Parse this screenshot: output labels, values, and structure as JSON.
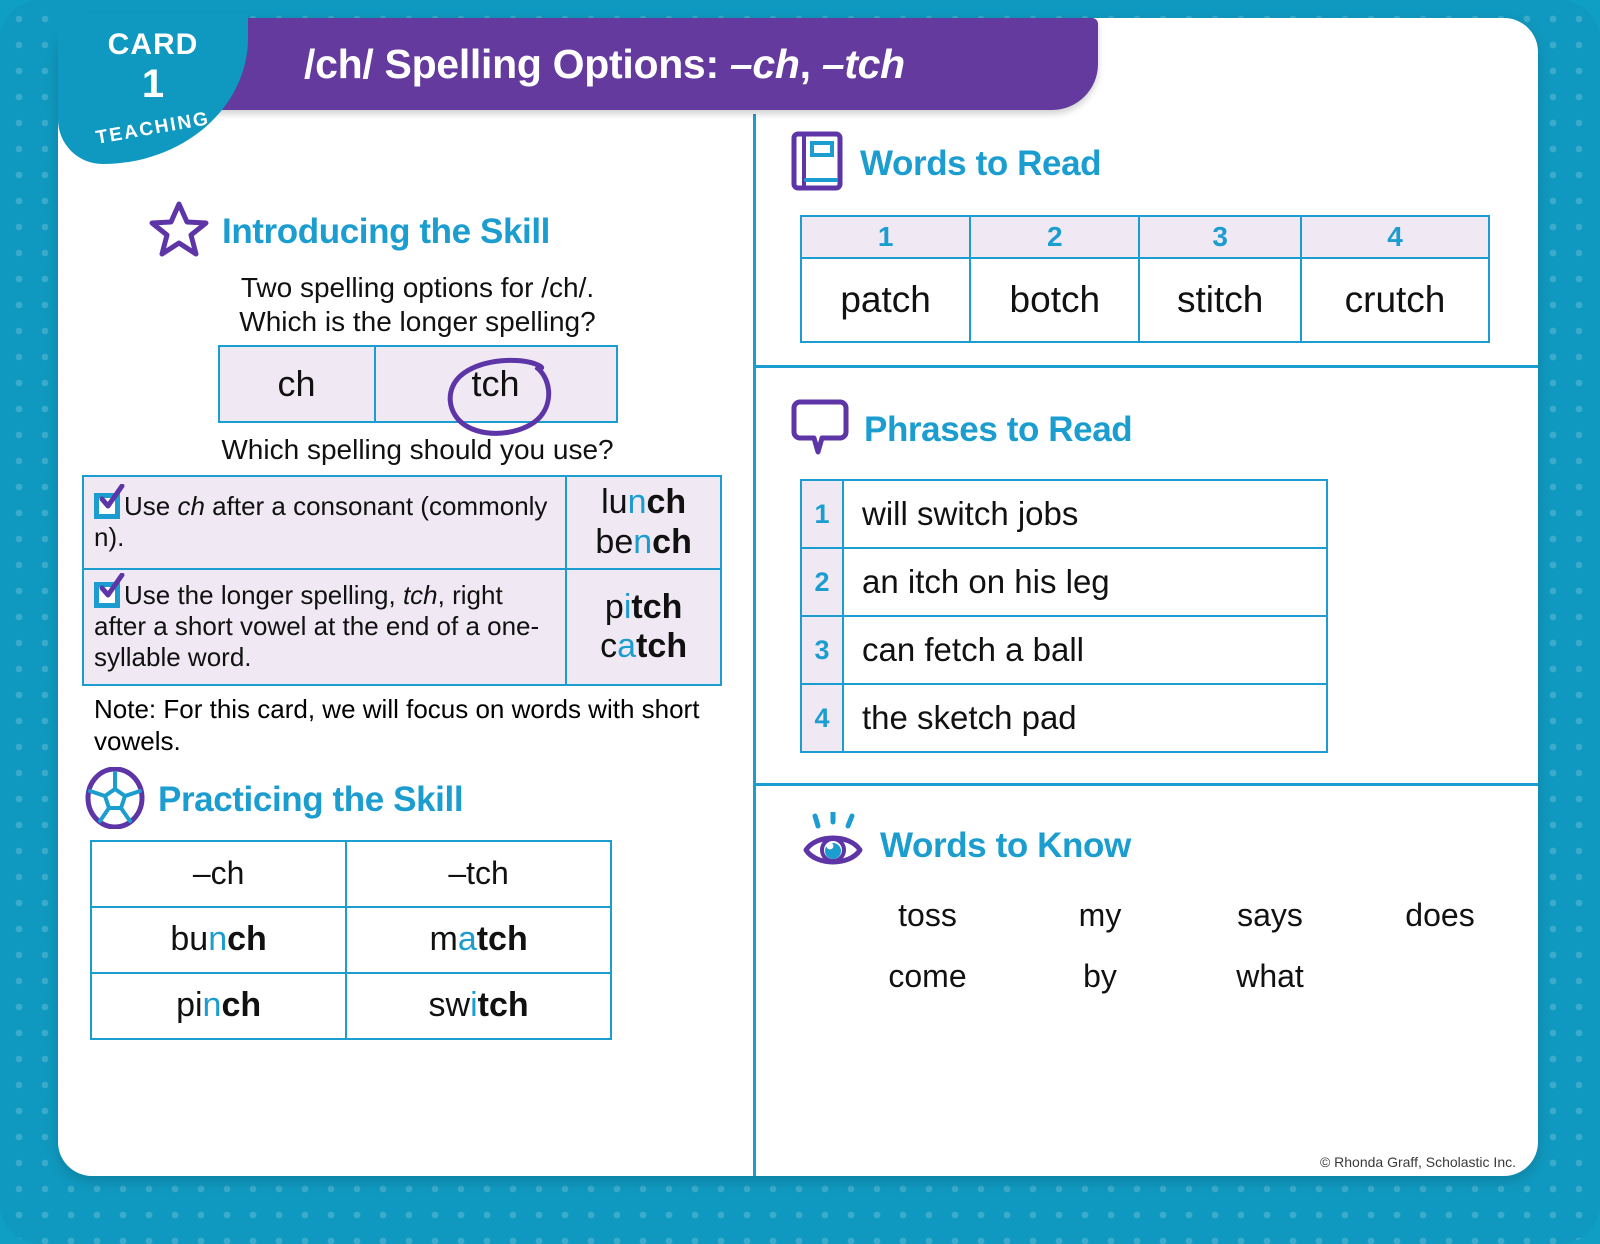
{
  "badge": {
    "card_label": "CARD",
    "number": "1",
    "type_label": "TEACHING"
  },
  "header": {
    "title_main": "/ch/ Spelling Options: ",
    "title_opt1": "–ch",
    "title_sep": ", ",
    "title_opt2": "–tch"
  },
  "left": {
    "intro": {
      "heading": "Introducing the Skill",
      "icon": "star-icon",
      "line1": "Two spelling options for /ch/.",
      "line2": "Which is the longer spelling?",
      "option_a": "ch",
      "option_b": "tch",
      "circled_option": "tch",
      "question2": "Which spelling should you use?"
    },
    "rules": [
      {
        "text_a": "Use ",
        "text_italic": "ch",
        "text_b": " after a consonant (commonly n).",
        "examples": [
          {
            "pre": "lu",
            "mid": "n",
            "post": "ch"
          },
          {
            "pre": "be",
            "mid": "n",
            "post": "ch"
          }
        ]
      },
      {
        "text_a": "Use the longer spelling, ",
        "text_italic": "tch",
        "text_b": ", right after a short vowel at the end of a one-syllable word.",
        "examples": [
          {
            "pre": "p",
            "mid": "i",
            "post": "tch"
          },
          {
            "pre": "c",
            "mid": "a",
            "post": "tch"
          }
        ]
      }
    ],
    "note": "Note: For this card, we will focus on words with short vowels.",
    "practice": {
      "heading": "Practicing the Skill",
      "icon": "ball-icon",
      "headers": [
        "–ch",
        "–tch"
      ],
      "rows": [
        [
          {
            "pre": "bu",
            "mid": "n",
            "post": "ch"
          },
          {
            "pre": "m",
            "mid": "a",
            "post": "tch"
          }
        ],
        [
          {
            "pre": "pi",
            "mid": "n",
            "post": "ch"
          },
          {
            "pre": "sw",
            "mid": "i",
            "post": "tch"
          }
        ]
      ]
    }
  },
  "right": {
    "words_to_read": {
      "heading": "Words to Read",
      "icon": "book-icon",
      "numbers": [
        "1",
        "2",
        "3",
        "4"
      ],
      "words": [
        "patch",
        "botch",
        "stitch",
        "crutch"
      ]
    },
    "phrases_to_read": {
      "heading": "Phrases to Read",
      "icon": "speech-bubble-icon",
      "rows": [
        {
          "num": "1",
          "phrase": "will switch jobs"
        },
        {
          "num": "2",
          "phrase": "an itch on his leg"
        },
        {
          "num": "3",
          "phrase": "can fetch a ball"
        },
        {
          "num": "4",
          "phrase": "the sketch pad"
        }
      ]
    },
    "words_to_know": {
      "heading": "Words to Know",
      "icon": "eye-icon",
      "row1": [
        "toss",
        "my",
        "says",
        "does"
      ],
      "row2": [
        "come",
        "by",
        "what"
      ]
    }
  },
  "footer": {
    "credit": "© Rhonda Graff, Scholastic Inc."
  },
  "colors": {
    "teal": "#1b9dd0",
    "teal_bg": "#1099c0",
    "purple": "#643a9e",
    "lavender": "#f0e9f4"
  }
}
